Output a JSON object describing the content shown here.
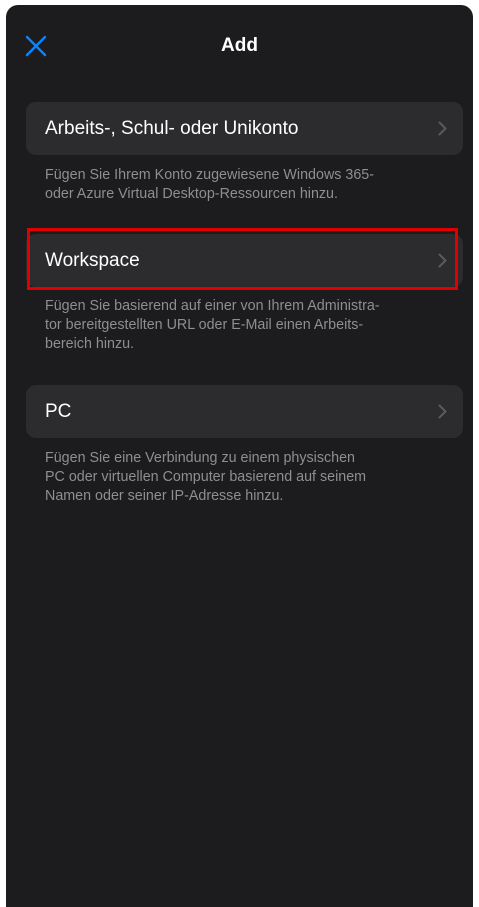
{
  "header": {
    "title": "Add",
    "close_icon": "close-icon",
    "accent_color": "#0a84ff"
  },
  "options": [
    {
      "label": "Arbeits-, Schul- oder Unikonto",
      "description": "Fügen Sie Ihrem Konto zugewiesene Windows 365-\noder Azure Virtual Desktop-Ressourcen hinzu.",
      "icon": "chevron-right-icon"
    },
    {
      "label": "Workspace",
      "description": "Fügen Sie basierend auf einer von Ihrem Administra-\ntor bereitgestellten URL oder E-Mail einen Arbeits-\nbereich hinzu.",
      "icon": "chevron-right-icon",
      "highlighted": true
    },
    {
      "label": "PC",
      "description": "Fügen Sie eine Verbindung zu einem physischen\nPC oder virtuellen Computer basierend auf seinem\nNamen oder seiner IP-Adresse hinzu.",
      "icon": "chevron-right-icon"
    }
  ],
  "colors": {
    "sheet_background": "#1c1c1e",
    "row_background": "#2c2c2e",
    "description_text": "#8e8e93",
    "highlight_border": "#e00000"
  }
}
